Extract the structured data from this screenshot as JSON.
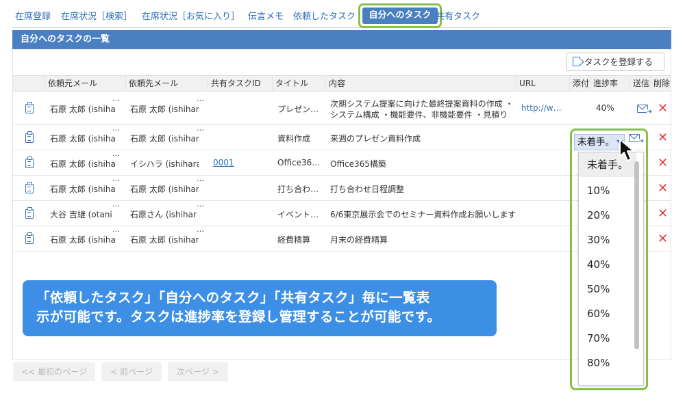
{
  "tabs": [
    {
      "label": "在席登録"
    },
    {
      "label": "在席状況［検索］"
    },
    {
      "label": "在席状況［お気に入り］"
    },
    {
      "label": "伝言メモ"
    },
    {
      "label": "依頼したタスク"
    },
    {
      "label": "自分へのタスク"
    },
    {
      "label": "共有タスク"
    }
  ],
  "section_title": "自分へのタスクの一覧",
  "register_button": "タスクを登録する",
  "table": {
    "headers": [
      "依頼元メール",
      "依頼先メール",
      "共有タスクID",
      "タイトル",
      "内容",
      "URL",
      "添付",
      "進捗率",
      "送信",
      "削除"
    ],
    "rows": [
      {
        "from": "石原 太郎 (ishiha",
        "to": "石原 太郎 (ishihar",
        "shared_id": "",
        "title": "プレゼン…",
        "content_1": "次期システム提案に向けた最終提案資料の作成 ・",
        "content_2": "システム構成 ・機能要件、非機能要件 ・見積り",
        "url": "http://w…",
        "progress": "40%"
      },
      {
        "from": "石原 太郎 (ishiha",
        "to": "石原 太郎 (ishihar",
        "shared_id": "",
        "title": "資料作成",
        "content_1": "来週のプレゼン資料作成",
        "content_2": "",
        "url": "",
        "progress": ""
      },
      {
        "from": "石原 太郎 (ishiha",
        "to": "イシハラ (ishihara",
        "shared_id": "0001",
        "title": "Office36…",
        "content_1": "Office365構築",
        "content_2": "",
        "url": "",
        "progress": ""
      },
      {
        "from": "石原 太郎 (ishiha",
        "to": "石原 太郎 (ishihar",
        "shared_id": "",
        "title": "打ち合わ…",
        "content_1": "打ち合わせ日程調整",
        "content_2": "",
        "url": "",
        "progress": ""
      },
      {
        "from": "大谷 吉継 (otani",
        "to": "石原さん (ishihar",
        "shared_id": "",
        "title": "イベント…",
        "content_1": "6/6東京展示会でのセミナー資料作成お願いします",
        "content_2": "",
        "url": "",
        "progress": ""
      },
      {
        "from": "石原 太郎 (ishiha",
        "to": "石原 太郎 (ishihar",
        "shared_id": "",
        "title": "経費精算",
        "content_1": "月末の経費精算",
        "content_2": "",
        "url": "",
        "progress": ""
      }
    ],
    "ellipsis": "…"
  },
  "dropdown": {
    "selected": "未着手。",
    "options": [
      "未着手。",
      "10%",
      "20%",
      "30%",
      "40%",
      "50%",
      "60%",
      "70%",
      "80%"
    ]
  },
  "callout": {
    "line1": "「依頼したタスク」「自分へのタスク」「共有タスク」毎に一覧表",
    "line2": "示が可能です。タスクは進捗率を登録し管理することが可能です。"
  },
  "pager": {
    "first": "<< 最初のページ",
    "prev": "< 前ページ",
    "next": "次ページ >"
  },
  "icons": {
    "task": "clipboard-icon",
    "send": "mail-send-icon",
    "delete": "close-icon",
    "register": "document-icon",
    "cursor": "mouse-pointer-icon"
  },
  "colors": {
    "accent": "#4a80c1",
    "link": "#2a6fb8",
    "highlight_frame": "#86c04a",
    "callout": "#3d8fe6",
    "delete": "#e03c3c"
  }
}
